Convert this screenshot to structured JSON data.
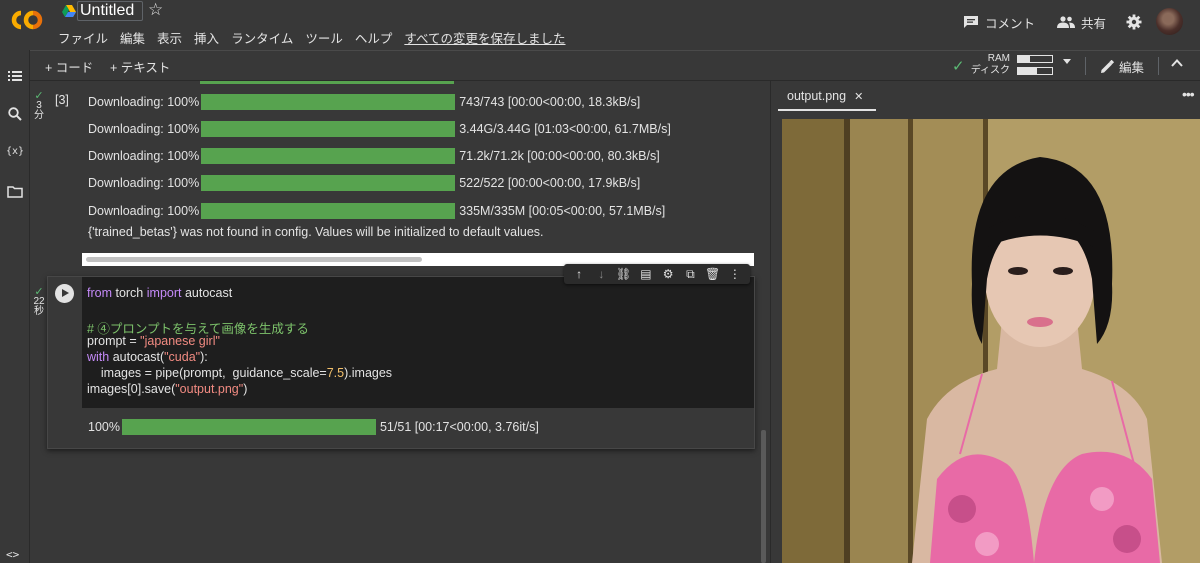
{
  "header": {
    "logo_text": "CO",
    "title": "Untitled",
    "menu": [
      "ファイル",
      "編集",
      "表示",
      "挿入",
      "ランタイム",
      "ツール",
      "ヘルプ"
    ],
    "saved_status": "すべての変更を保存しました",
    "comment_label": "コメント",
    "share_label": "共有"
  },
  "toolbar": {
    "add_code": "+ コード",
    "add_text": "+ テキスト",
    "ram_label": "RAM",
    "disk_label": "ディスク",
    "ram_fraction": 0.35,
    "disk_fraction": 0.55,
    "edit_label": "編集"
  },
  "cell1": {
    "exec_time": "3",
    "exec_unit": "分",
    "exec_count": "[3]",
    "outputs": [
      {
        "label": "Downloading: 100%",
        "progress": 1.0,
        "stats": "743/743 [00:00<00:00, 18.3kB/s]"
      },
      {
        "label": "Downloading: 100%",
        "progress": 1.0,
        "stats": "3.44G/3.44G [01:03<00:00, 61.7MB/s]"
      },
      {
        "label": "Downloading: 100%",
        "progress": 1.0,
        "stats": "71.2k/71.2k [00:00<00:00, 80.3kB/s]"
      },
      {
        "label": "Downloading: 100%",
        "progress": 1.0,
        "stats": "522/522 [00:00<00:00, 17.9kB/s]"
      },
      {
        "label": "Downloading: 100%",
        "progress": 1.0,
        "stats": "335M/335M [00:05<00:00, 57.1MB/s]"
      }
    ],
    "warning": "{'trained_betas'} was not found in config. Values will be initialized to default values."
  },
  "cell2": {
    "exec_time": "22",
    "exec_unit": "秒",
    "code": {
      "l1_kw1": "from",
      "l1_mod": " torch ",
      "l1_kw2": "import",
      "l1_name": " autocast",
      "l3_comment": "# ④プロンプトを与えて画像を生成する",
      "l4_a": "prompt = ",
      "l4_str": "\"japanese girl\"",
      "l5_kw": "with",
      "l5_a": " autocast(",
      "l5_str": "\"cuda\"",
      "l5_b": "):",
      "l6_a": "    images = pipe(prompt,  guidance_scale=",
      "l6_num": "7.5",
      "l6_b": ").images",
      "l7_a": "images[0].save(",
      "l7_str": "\"output.png\"",
      "l7_b": ")"
    },
    "output": {
      "label": "100%",
      "progress": 1.0,
      "stats": "51/51 [00:17<00:00, 3.76it/s]"
    }
  },
  "image_pane": {
    "tab_label": "output.png",
    "close_glyph": "✕",
    "more_glyph": "•••"
  },
  "colors": {
    "progress": "#57a34f",
    "accent_green": "#5bb974",
    "background": "#383838",
    "code_background": "#1e1e1e"
  }
}
